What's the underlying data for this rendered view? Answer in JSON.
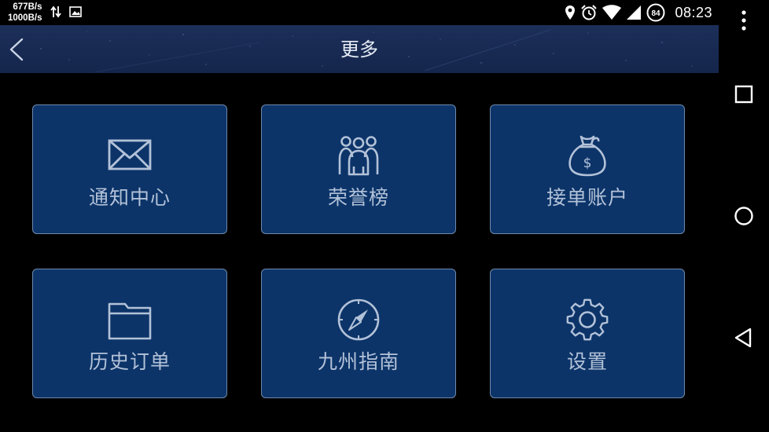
{
  "status_bar": {
    "net_up": "677B/s",
    "net_down": "1000B/s",
    "battery_level": "84",
    "time": "08:23",
    "icons": [
      "arrows-updown-icon",
      "gallery-icon",
      "location-pin-icon",
      "alarm-icon",
      "wifi-icon",
      "signal-icon",
      "battery-icon"
    ]
  },
  "header": {
    "title": "更多",
    "back_icon": "chevron-left-icon"
  },
  "tiles": [
    {
      "label": "通知中心",
      "icon": "envelope-icon"
    },
    {
      "label": "荣誉榜",
      "icon": "people-group-icon"
    },
    {
      "label": "接单账户",
      "icon": "money-bag-icon"
    },
    {
      "label": "历史订单",
      "icon": "folder-icon"
    },
    {
      "label": "九州指南",
      "icon": "compass-icon"
    },
    {
      "label": "设置",
      "icon": "gear-icon"
    }
  ],
  "nav_bar": {
    "items": [
      "overflow-menu-icon",
      "recents-square-icon",
      "home-circle-icon",
      "back-triangle-icon"
    ]
  },
  "colors": {
    "background": "#000000",
    "header_bg": "#1c2f59",
    "tile_bg": "#0c3469",
    "tile_border": "#6f89ab",
    "tile_content": "#b3c2d8"
  }
}
